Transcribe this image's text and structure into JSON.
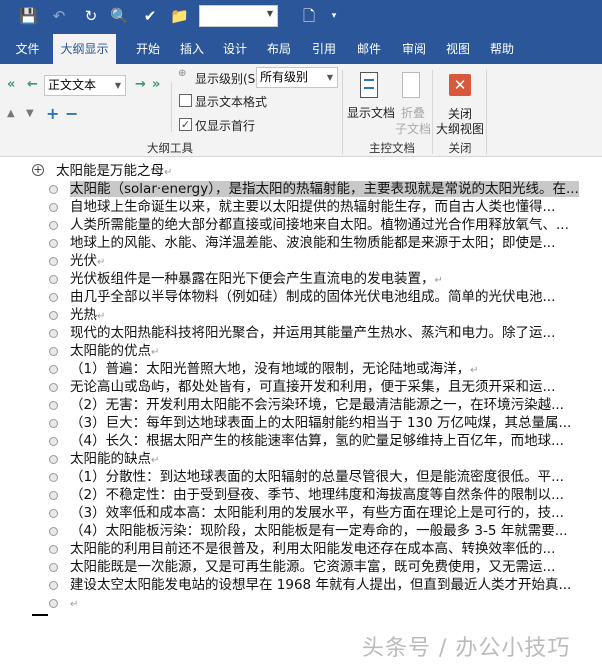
{
  "qat": {
    "icons": [
      "save-icon",
      "undo-icon",
      "redo-icon",
      "print-preview-icon",
      "touch-mode-icon",
      "open-folder-icon",
      "new-document-icon",
      "customize-icon"
    ],
    "font_combo_value": ""
  },
  "tabs": [
    "文件",
    "大纲显示",
    "开始",
    "插入",
    "设计",
    "布局",
    "引用",
    "邮件",
    "审阅",
    "视图",
    "帮助"
  ],
  "active_tab": "大纲显示",
  "ribbon": {
    "level_combo": "正文文本",
    "show_level_label": "显示级别(S):",
    "show_level_value": "所有级别",
    "show_text_format": "显示文本格式",
    "show_text_format_checked": false,
    "show_first_line": "仅显示首行",
    "show_first_line_checked": true,
    "group_outline_tools": "大纲工具",
    "show_document": "显示文档",
    "collapse_subdocs_1": "折叠",
    "collapse_subdocs_2": "子文档",
    "group_master_doc": "主控文档",
    "close_outline_1": "关闭",
    "close_outline_2": "大纲视图",
    "group_close": "关闭"
  },
  "document": {
    "heading": "太阳能是万能之母",
    "items": [
      "太阳能（solar·energy），是指太阳的热辐射能，主要表现就是常说的太阳光线。在...",
      "自地球上生命诞生以来，就主要以太阳提供的热辐射能生存，而自古人类也懂得...",
      "人类所需能量的绝大部分都直接或间接地来自太阳。植物通过光合作用释放氧气、...",
      "地球上的风能、水能、海洋温差能、波浪能和生物质能都是来源于太阳；即使是...",
      "光伏",
      "光伏板组件是一种暴露在阳光下便会产生直流电的发电装置，",
      "由几乎全部以半导体物料（例如硅）制成的固体光伏电池组成。简单的光伏电池...",
      "光热",
      "现代的太阳热能科技将阳光聚合，并运用其能量产生热水、蒸汽和电力。除了运...",
      "太阳能的优点",
      "（1）普遍：太阳光普照大地，没有地域的限制，无论陆地或海洋，",
      "无论高山或岛屿，都处处皆有，可直接开发和利用，便于采集，且无须开采和运...",
      "（2）无害：开发利用太阳能不会污染环境，它是最清洁能源之一，在环境污染越...",
      "（3）巨大：每年到达地球表面上的太阳辐射能约相当于 130 万亿吨煤，其总量属...",
      "（4）长久：根据太阳产生的核能速率估算，氢的贮量足够维持上百亿年，而地球...",
      "太阳能的缺点",
      "（1）分散性：到达地球表面的太阳辐射的总量尽管很大，但是能流密度很低。平...",
      "（2）不稳定性：由于受到昼夜、季节、地理纬度和海拔高度等自然条件的限制以...",
      "（3）效率低和成本高：太阳能利用的发展水平，有些方面在理论上是可行的，技...",
      "（4）太阳能板污染：现阶段，太阳能板是有一定寿命的，一般最多 3-5 年就需要...",
      "太阳能的利用目前还不是很普及，利用太阳能发电还存在成本高、转换效率低的...",
      "太阳能既是一次能源，又是可再生能源。它资源丰富，既可免费使用，又无需运...",
      "建设太空太阳能发电站的设想早在 1968 年就有人提出，但直到最近人类才开始真...",
      ""
    ],
    "para_mark": "↵"
  },
  "watermark": "头条号 / 办公小技巧"
}
